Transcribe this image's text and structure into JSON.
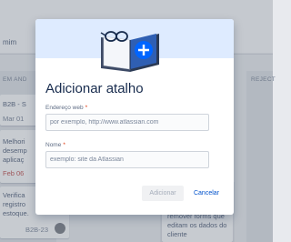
{
  "background": {
    "user_label": "mim",
    "columns": {
      "left_header": "EM AND",
      "right_header": "REJECT"
    },
    "cards": {
      "card1_title": "B2B - S",
      "card1_date": "Mar 01",
      "card2_lines": [
        "Melhori",
        "desemp",
        "aplicaç"
      ],
      "card2_date": "Feb 06",
      "card3_lines": [
        "Verifica",
        "registro",
        "estoque."
      ],
      "card3_key": "B2B-23",
      "mid_card_lines": [
        "remover forms que",
        "editam os dados do",
        "cliente"
      ]
    }
  },
  "modal": {
    "title": "Adicionar atalho",
    "illustration_icon": "book-with-glasses-and-plus-icon",
    "fields": {
      "url": {
        "label": "Endereço web",
        "required_mark": "*",
        "placeholder": "por exemplo, http://www.atlassian.com",
        "value": ""
      },
      "name": {
        "label": "Nome",
        "required_mark": "*",
        "placeholder": "exemplo: site da Atlassian",
        "value": ""
      }
    },
    "buttons": {
      "add": "Adicionar",
      "cancel": "Cancelar"
    }
  },
  "colors": {
    "accent": "#0052cc",
    "required": "#de350b",
    "hero": "#deebff"
  }
}
